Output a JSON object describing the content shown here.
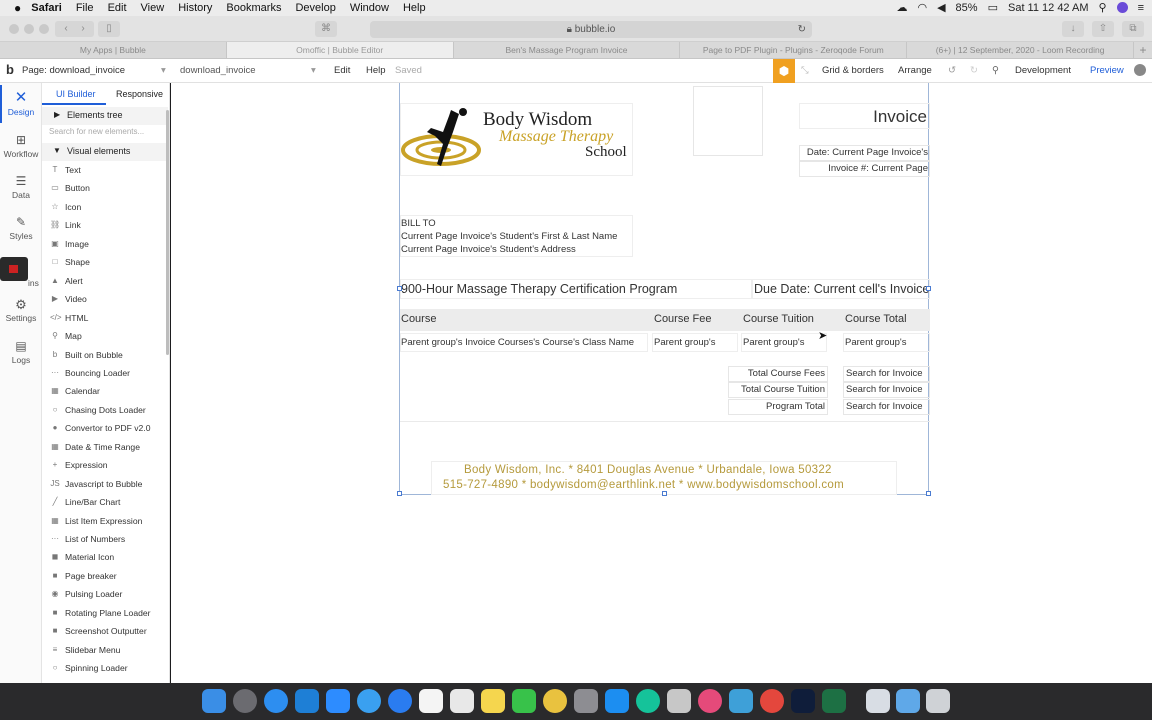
{
  "menubar": {
    "apple": "",
    "items": [
      "Safari",
      "File",
      "Edit",
      "View",
      "History",
      "Bookmarks",
      "Develop",
      "Window",
      "Help"
    ],
    "battery": "85%",
    "clock": "Sat 11 12 42 AM"
  },
  "safari": {
    "url": "bubble.io"
  },
  "tabs": [
    "My Apps | Bubble",
    "Omoffic | Bubble Editor",
    "Ben's Massage Program Invoice",
    "Page to PDF Plugin - Plugins - Zeroqode Forum",
    "(6+) | 12 September, 2020 - Loom Recording"
  ],
  "editor": {
    "page_label": "Page: download_invoice",
    "element_select": "download_invoice",
    "edit": "Edit",
    "help": "Help",
    "saved": "Saved",
    "grid": "Grid & borders",
    "arrange": "Arrange",
    "development": "Development",
    "preview": "Preview"
  },
  "rail": {
    "design": "Design",
    "workflow": "Workflow",
    "data": "Data",
    "styles": "Styles",
    "plugins": "ins",
    "settings": "Settings",
    "logs": "Logs"
  },
  "panel": {
    "tab_builder": "UI Builder",
    "tab_responsive": "Responsive",
    "elements_tree": "Elements tree",
    "search_placeholder": "Search for new elements...",
    "visual_elements": "Visual elements",
    "items": [
      {
        "icon": "T",
        "label": "Text"
      },
      {
        "icon": "▭",
        "label": "Button"
      },
      {
        "icon": "☆",
        "label": "Icon"
      },
      {
        "icon": "⛓",
        "label": "Link"
      },
      {
        "icon": "▣",
        "label": "Image"
      },
      {
        "icon": "□",
        "label": "Shape"
      },
      {
        "icon": "▲",
        "label": "Alert"
      },
      {
        "icon": "▶",
        "label": "Video"
      },
      {
        "icon": "</>",
        "label": "HTML"
      },
      {
        "icon": "⚲",
        "label": "Map"
      },
      {
        "icon": "b",
        "label": "Built on Bubble"
      },
      {
        "icon": "···",
        "label": "Bouncing Loader"
      },
      {
        "icon": "▦",
        "label": "Calendar"
      },
      {
        "icon": "○",
        "label": "Chasing Dots Loader"
      },
      {
        "icon": "●",
        "label": "Convertor to PDF v2.0"
      },
      {
        "icon": "▦",
        "label": "Date & Time Range"
      },
      {
        "icon": "+",
        "label": "Expression"
      },
      {
        "icon": "JS",
        "label": "Javascript to Bubble"
      },
      {
        "icon": "╱",
        "label": "Line/Bar Chart"
      },
      {
        "icon": "▦",
        "label": "List Item Expression"
      },
      {
        "icon": "···",
        "label": "List of Numbers"
      },
      {
        "icon": "◼",
        "label": "Material Icon"
      },
      {
        "icon": "■",
        "label": "Page breaker"
      },
      {
        "icon": "◉",
        "label": "Pulsing Loader"
      },
      {
        "icon": "■",
        "label": "Rotating Plane Loader"
      },
      {
        "icon": "■",
        "label": "Screenshot Outputter"
      },
      {
        "icon": "≡",
        "label": "Slidebar Menu"
      },
      {
        "icon": "○",
        "label": "Spinning Loader"
      }
    ]
  },
  "invoice": {
    "logo_line1": "Body Wisdom",
    "logo_line2": "Massage Therapy",
    "logo_line3": "School",
    "title": "Invoice",
    "date": "Date: Current Page Invoice's",
    "number": "Invoice #: Current Page",
    "bill_to": "BILL TO",
    "student_name": "Current Page Invoice's Student's First & Last Name",
    "student_address": "Current Page Invoice's Student's Address",
    "program": "900-Hour Massage Therapy Certification Program",
    "due_date": "Due Date: Current cell's Invoice's",
    "columns": [
      "Course",
      "Course Fee",
      "Course Tuition",
      "Course Total"
    ],
    "row": [
      "Parent group's Invoice Courses's Course's Class Name",
      "Parent group's",
      "Parent group's",
      "Parent group's"
    ],
    "totals": [
      {
        "label": "Total Course Fees",
        "value": "Search for Invoice"
      },
      {
        "label": "Total Course Tuition",
        "value": "Search for Invoice"
      },
      {
        "label": "Program Total",
        "value": "Search for Invoice"
      }
    ],
    "footer_line1": "Body Wisdom, Inc.  * 8401 Douglas Avenue  *  Urbandale, Iowa  50322",
    "footer_line2": "515-727-4890  *  bodywisdom@earthlink.net  *  www.bodywisdomschool.com",
    "footer_color": "#b59a3c",
    "logo_gold": "#c9a227"
  },
  "colors": {
    "accent": "#1f5ed8",
    "bubble_orange": "#f0a020"
  }
}
